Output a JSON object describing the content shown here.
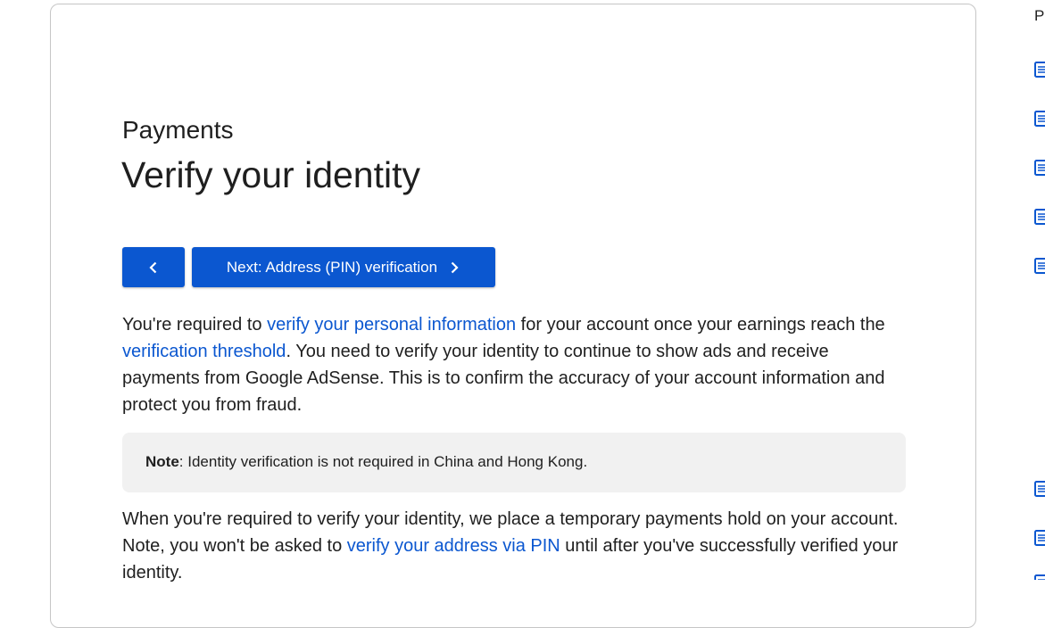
{
  "article": {
    "eyebrow": "Payments",
    "title": "Verify your identity",
    "prev_icon": "chevron-left-icon",
    "next_label": "Next: Address (PIN) verification",
    "next_icon": "chevron-right-icon",
    "p1": {
      "t1": "You're required to ",
      "link1": "verify your personal information",
      "t2": " for your account once your earnings reach the ",
      "link2": "verification threshold",
      "t3": ". You need to verify your identity to continue to show ads and receive payments from Google AdSense. This is to confirm the accuracy of your account information and protect you from fraud."
    },
    "note": {
      "label": "Note",
      "text": ": Identity verification is not required in China and Hong Kong."
    },
    "p2": {
      "t1": "When you're required to verify your identity, we place a temporary payments hold on your account. Note, you won't be asked to ",
      "link": "verify your address via PIN",
      "t2": " until after you've successfully verified your identity."
    }
  },
  "sidebar": {
    "title_partial": "P",
    "item_icon": "article-icon",
    "colors": {
      "link": "#0b57d0",
      "button": "#0b57d0",
      "note_bg": "#f1f1f1"
    }
  }
}
